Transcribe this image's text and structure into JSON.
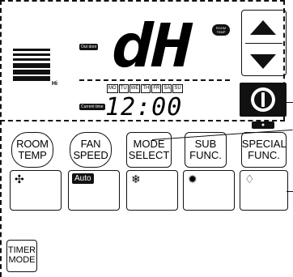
{
  "display": {
    "outdoor_label": "Out door",
    "room_temp_label": "ROOM TEMP",
    "main_readout": "dH",
    "fan_level_label": "Hi",
    "current_time_label": "Current time",
    "clock": "12:00",
    "days": [
      "MO",
      "TU",
      "WE",
      "TH",
      "FR",
      "SA",
      "SU"
    ],
    "drop_indicator": "ෆ"
  },
  "buttons": {
    "room_temp": "ROOM TEMP",
    "fan_speed": "FAN SPEED",
    "mode_select": "MODE SELECT",
    "sub_func": "SUB FUNC.",
    "special_func": "SPECIAL FUNC.",
    "timer_mode": "TIMER MODE"
  },
  "modes": {
    "fan": "fan-icon",
    "auto": "Auto",
    "cool": "snowflake-icon",
    "heat": "sun-icon",
    "dry": "drop-icon"
  }
}
